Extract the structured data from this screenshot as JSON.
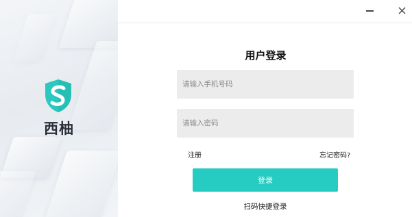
{
  "brand": {
    "name": "西柚",
    "logo_icon": "shield-s-logo-icon",
    "logo_color": "#2bc8bf"
  },
  "window": {
    "minimize_icon": "minimize-icon",
    "close_icon": "close-icon"
  },
  "login": {
    "title": "用户登录",
    "phone_placeholder": "请输入手机号码",
    "password_placeholder": "请输入密码",
    "register_label": "注册",
    "forgot_label": "忘记密码?",
    "submit_label": "登录",
    "qr_label": "扫码快捷登录",
    "accent_color": "#26cbc1"
  }
}
